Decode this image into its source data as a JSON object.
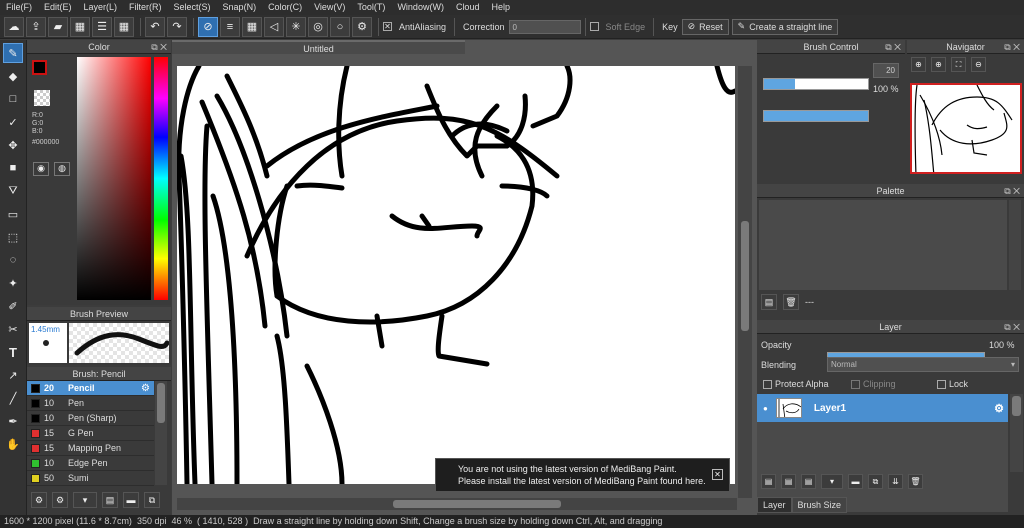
{
  "menu": [
    "File(F)",
    "Edit(E)",
    "Layer(L)",
    "Filter(R)",
    "Select(S)",
    "Snap(N)",
    "Color(C)",
    "View(V)",
    "Tool(T)",
    "Window(W)",
    "Cloud",
    "Help"
  ],
  "toolbar": {
    "antialiasing": "AntiAliasing",
    "correction_label": "Correction",
    "correction_value": "0",
    "soft_edge": "Soft Edge",
    "key_label": "Key",
    "reset_label": "Reset",
    "straight_line_label": "Create a straight line"
  },
  "color_panel": {
    "title": "Color",
    "r": "R:0",
    "g": "G:0",
    "b": "B:0",
    "hex": "#000000",
    "primary_color": "#cc1111",
    "secondary_color": "#000000"
  },
  "brush_preview": {
    "title": "Brush Preview",
    "size": "1.45mm"
  },
  "brush_list": {
    "title": "Brush: Pencil",
    "items": [
      {
        "size": "20",
        "name": "Pencil",
        "color": "#000000",
        "selected": true
      },
      {
        "size": "10",
        "name": "Pen",
        "color": "#000000"
      },
      {
        "size": "10",
        "name": "Pen (Sharp)",
        "color": "#000000"
      },
      {
        "size": "15",
        "name": "G Pen",
        "color": "#e03030"
      },
      {
        "size": "15",
        "name": "Mapping Pen",
        "color": "#e03030"
      },
      {
        "size": "10",
        "name": "Edge Pen",
        "color": "#30c030"
      },
      {
        "size": "50",
        "name": "Sumi",
        "color": "#e0d020"
      }
    ]
  },
  "document": {
    "title": "Untitled"
  },
  "update_notice": {
    "line1": "You are not using the latest version of MediBang Paint.",
    "line2": "Please install the latest version of MediBang Paint found here.",
    "close": "✕"
  },
  "brush_control": {
    "title": "Brush Control",
    "size_value": "20",
    "size_fill": 0.3,
    "opacity_value": "100 %",
    "opacity_fill": 1.0
  },
  "navigator": {
    "title": "Navigator"
  },
  "palette": {
    "title": "Palette",
    "footer": "---"
  },
  "layer_panel": {
    "title": "Layer",
    "opacity_label": "Opacity",
    "opacity_value": "100 %",
    "opacity_fill": 1.0,
    "blending_label": "Blending",
    "blending_value": "Normal",
    "protect_alpha": "Protect Alpha",
    "clipping": "Clipping",
    "lock": "Lock",
    "layers": [
      {
        "name": "Layer1",
        "visible": true
      }
    ]
  },
  "bottom_tabs": [
    "Layer",
    "Brush Size"
  ],
  "status": {
    "dimensions": "1600 * 1200 pixel",
    "physical": "(11.6 * 8.7cm)",
    "dpi": "350 dpi",
    "zoom": "46 %",
    "coords": "( 1410, 528 )",
    "hint": "Draw a straight line by holding down Shift, Change a brush size by holding down Ctrl, Alt, and dragging"
  }
}
